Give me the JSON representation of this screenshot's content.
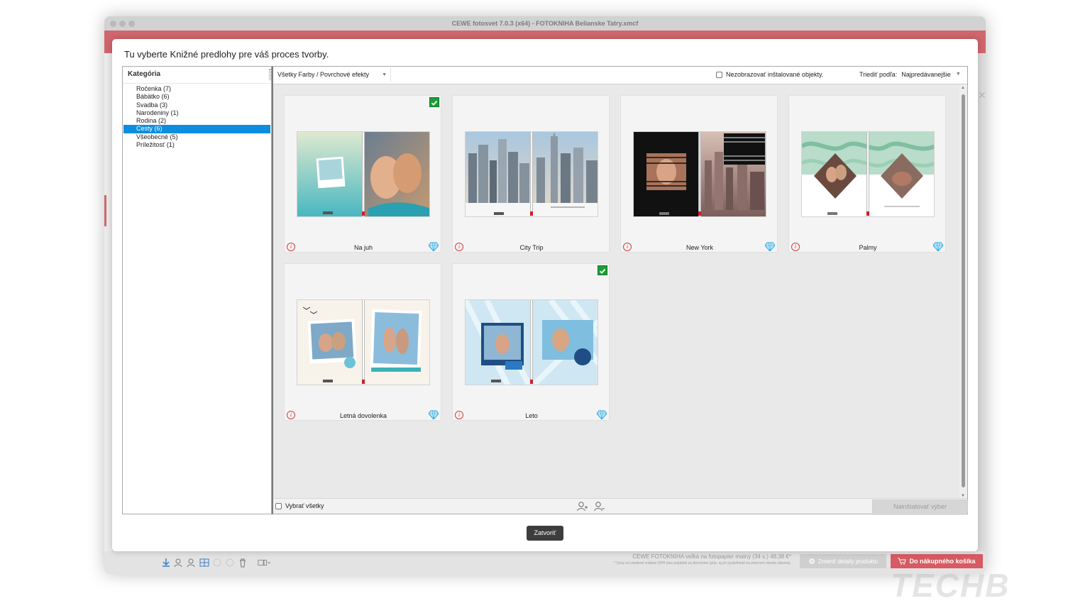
{
  "window": {
    "title": "CEWE fotosvet 7.0.3 (x64) - FOTOKNIHA Belianske Tatry.xmcf"
  },
  "dialog": {
    "title": "Tu vyberte Knižné predlohy pre váš proces tvorby.",
    "category_header": "Kategória",
    "categories": [
      {
        "label": "Ročenka (7)",
        "selected": false
      },
      {
        "label": "Bábätko (6)",
        "selected": false
      },
      {
        "label": "Svadba (3)",
        "selected": false
      },
      {
        "label": "Narodeniny (1)",
        "selected": false
      },
      {
        "label": "Rodina (2)",
        "selected": false
      },
      {
        "label": "Cesty (6)",
        "selected": true
      },
      {
        "label": "Všeobecné (5)",
        "selected": false
      },
      {
        "label": "Príležitosť (1)",
        "selected": false
      }
    ],
    "filter": {
      "selected": "Všetky Farby / Povrchové efekty"
    },
    "hide_installed_label": "Nezobrazovať inštalované objekty.",
    "sort_label": "Triediť podľa:",
    "sort_value": "Najpredávanejšie",
    "templates": [
      {
        "name": "Na juh",
        "installed": true,
        "premium": true
      },
      {
        "name": "City Trip",
        "installed": false,
        "premium": false
      },
      {
        "name": "New York",
        "installed": false,
        "premium": true
      },
      {
        "name": "Palmy",
        "installed": false,
        "premium": true
      },
      {
        "name": "Letná dovolenka",
        "installed": false,
        "premium": true
      },
      {
        "name": "Leto",
        "installed": true,
        "premium": true
      }
    ],
    "select_all_label": "Vybrať všetky",
    "install_button": "Nainštalovať výber",
    "close_button": "Zatvoriť"
  },
  "app_bottom": {
    "product_info": "CEWE FOTOKNIHA veľká na fotopapier matný (34 s.) 48,38 €*",
    "product_note": "* Ceny sú uvedené vrátane DPH plus poplatok za doručenie (príp. aj pri vyzdvihnutí na zbernom mieste zdarma).",
    "change_details": "Zmeniť detaily produktu",
    "cart": "Do nákupného košíka"
  },
  "watermark": "TECHB",
  "colors": {
    "accent_red": "#d0676d",
    "selection_blue": "#0c8ee0",
    "check_green": "#1d9d3a"
  }
}
